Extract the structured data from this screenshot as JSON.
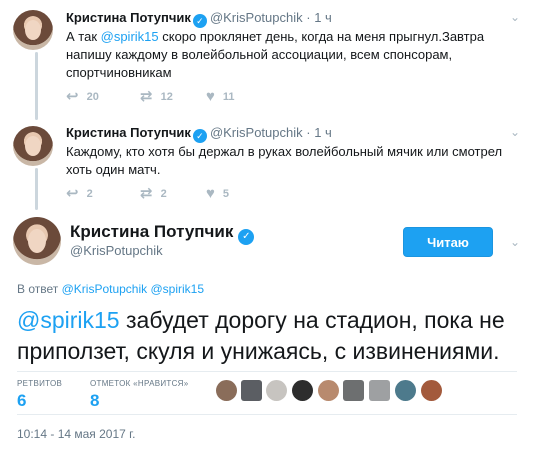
{
  "thread": [
    {
      "name": "Кристина Потупчик",
      "handle": "@KrisPotupchik",
      "time": "· 1 ч",
      "text_before": "А так ",
      "mention": "@spirik15",
      "text_after": " скоро проклянет день, когда на меня прыгнул.Завтра напишу каждому в волейбольной ассоциации, всем спонсорам, спортчиновникам",
      "replies": "20",
      "retweets": "12",
      "likes": "11"
    },
    {
      "name": "Кристина Потупчик",
      "handle": "@KrisPotupchik",
      "time": "· 1 ч",
      "text": "Каждому, кто хотя бы держал в руках волейбольный мячик или смотрел хоть один матч.",
      "replies": "2",
      "retweets": "2",
      "likes": "5"
    }
  ],
  "main_tweet": {
    "name": "Кристина Потупчик",
    "handle": "@KrisPotupchik",
    "follow_label": "Читаю",
    "reply_prefix": "В ответ ",
    "reply_handles": "@KrisPotupchik @spirik15",
    "mention": "@spirik15",
    "text": " забудет дорогу на стадион, пока не приползет, скуля и унижаясь, с извинениями.",
    "retweets_label": "РЕТВИТОВ",
    "retweets": "6",
    "likes_label": "ОТМЕТОК «НРАВИТСЯ»",
    "likes": "8",
    "date": "10:14 - 14 мая 2017 г."
  },
  "colors": {
    "accent": "#1da1f2",
    "muted": "#657786",
    "icon": "#aab8c2"
  },
  "icons": {
    "reply": "reply-icon",
    "retweet": "retweet-icon",
    "like": "heart-icon",
    "more": "chevron-down-icon",
    "verified": "verified-badge-icon"
  }
}
